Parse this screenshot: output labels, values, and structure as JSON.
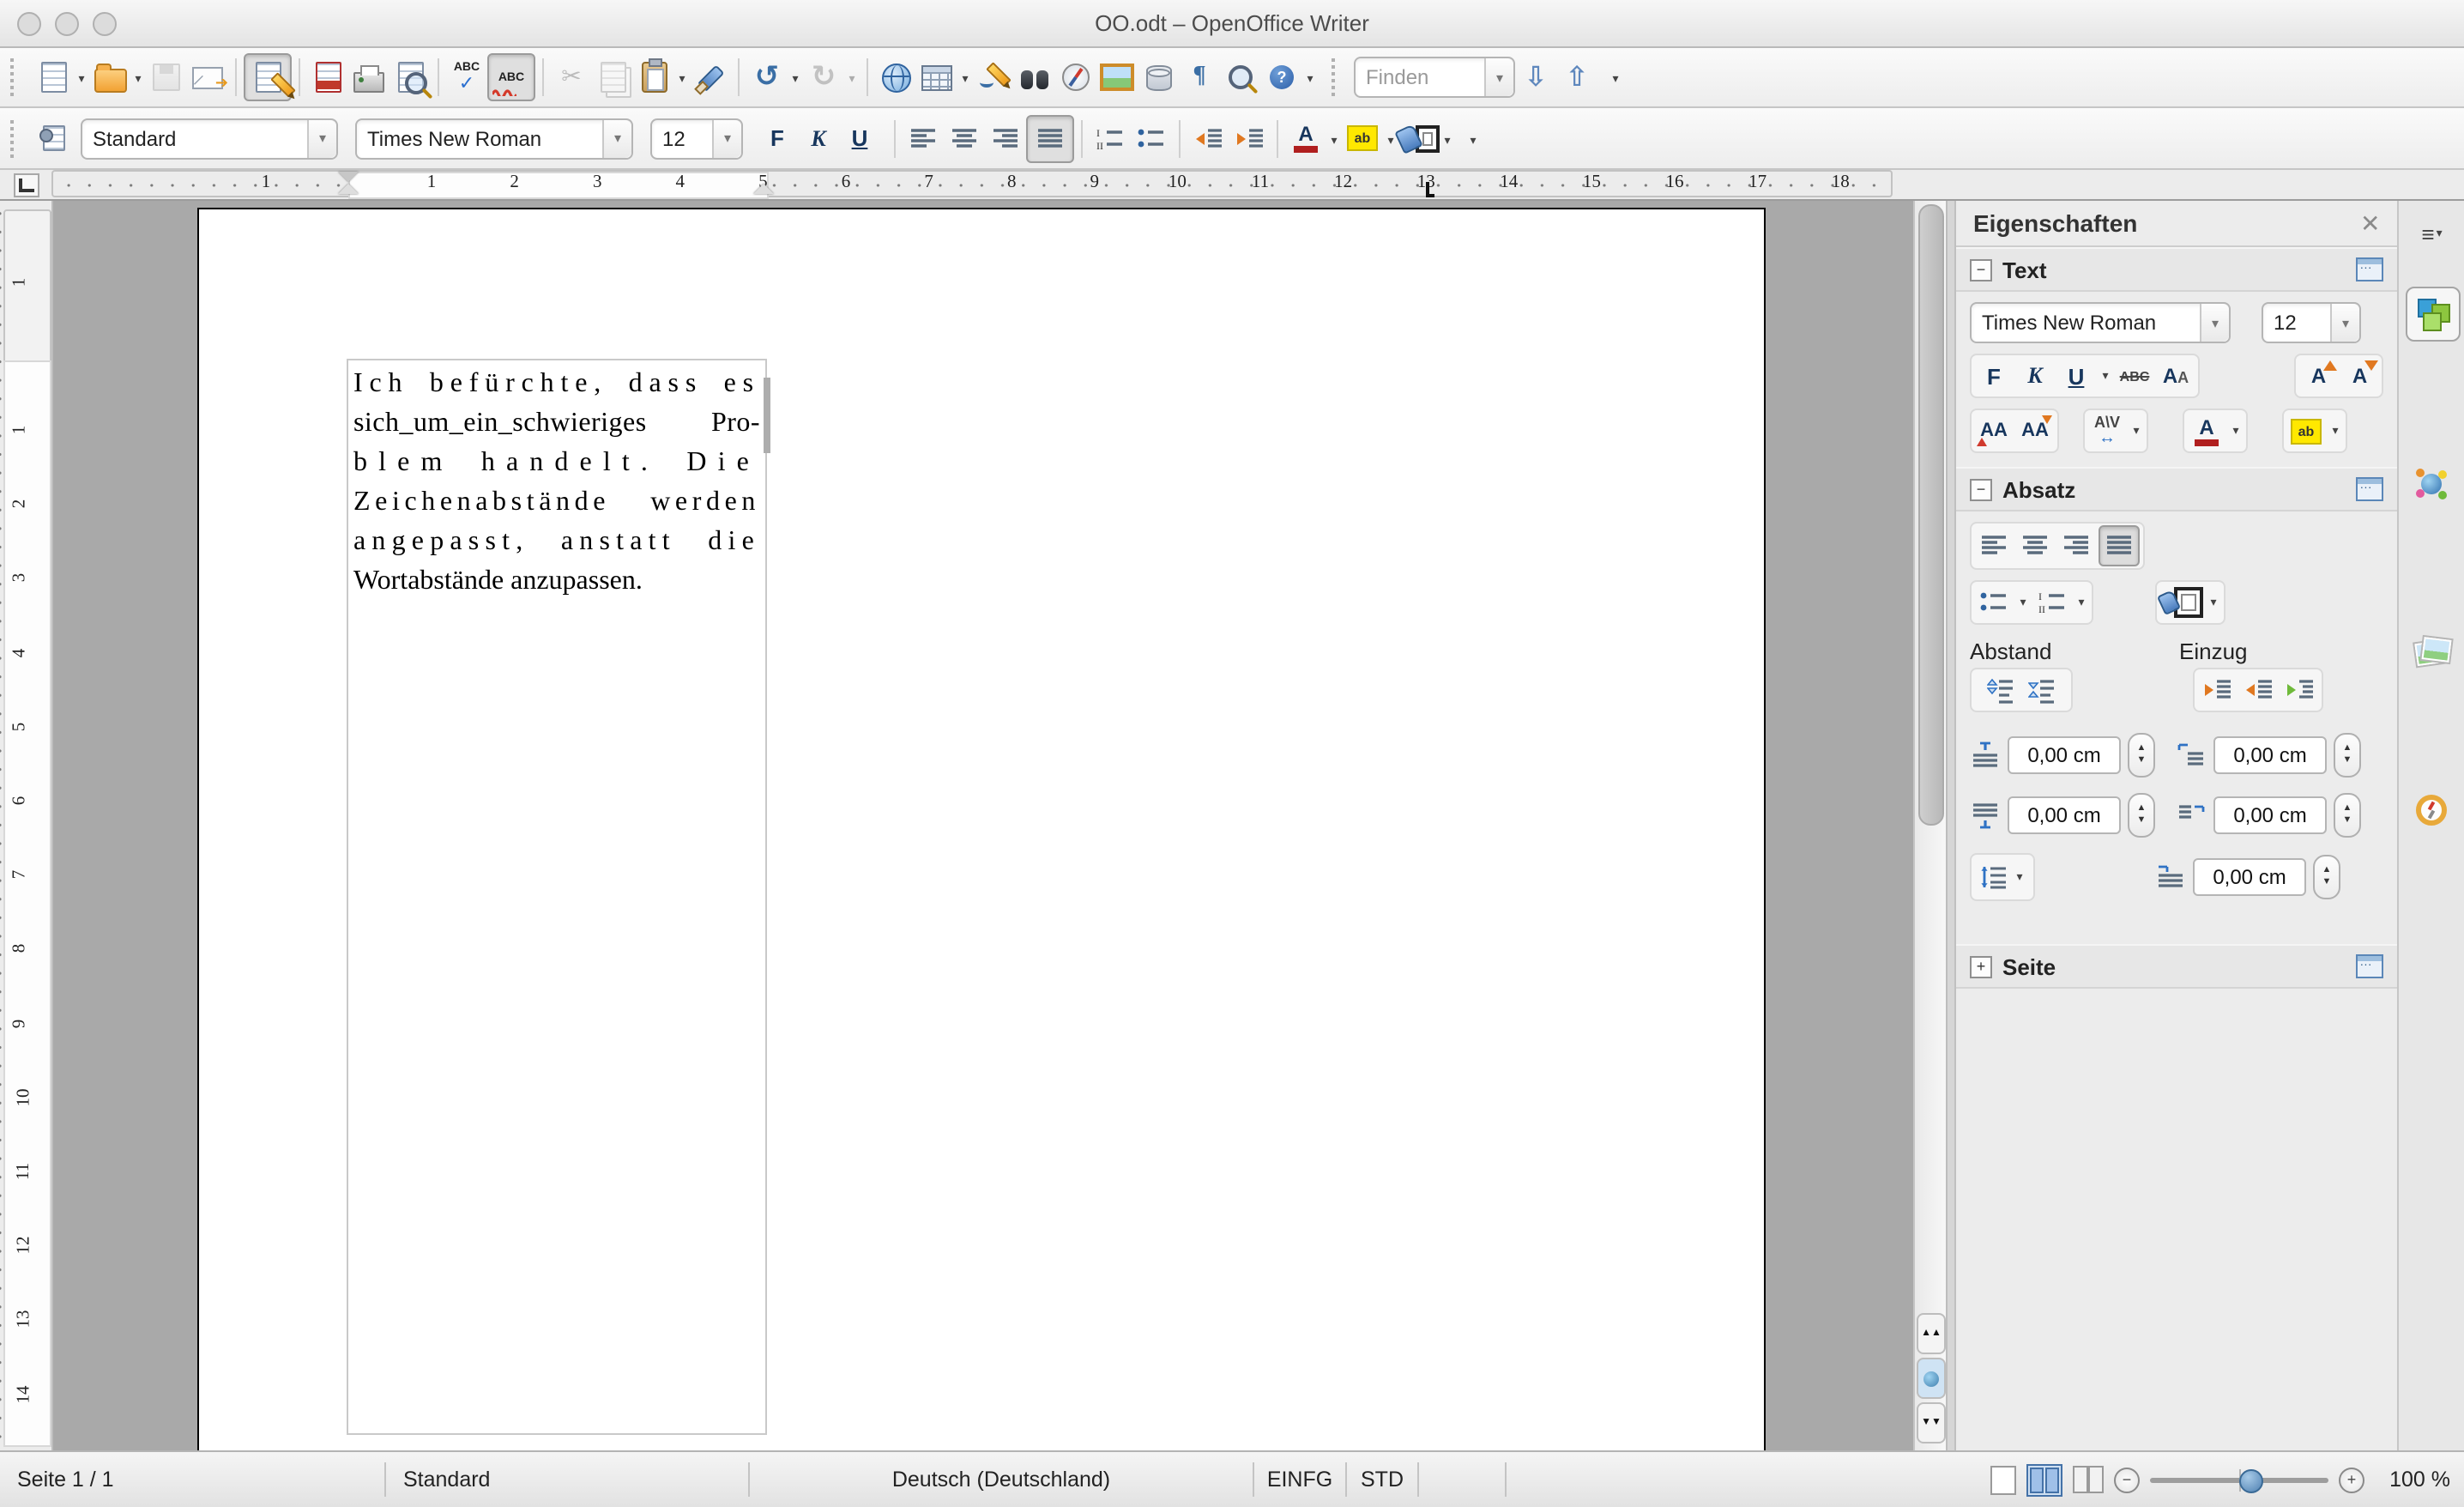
{
  "window": {
    "title": "OO.odt – OpenOffice Writer"
  },
  "icons": {
    "overflow": "▾",
    "scissors": "✂",
    "mail_arrow": "➔",
    "undo": "↺",
    "redo": "↻",
    "pilcrow": "¶",
    "check": "✓",
    "find_down": "⇩",
    "find_up": "⇧",
    "menu": "≡",
    "close": "✕",
    "minus": "−",
    "plus": "+",
    "spin_up": "▲",
    "spin_down": "▼",
    "nav_up": "▲▲",
    "nav_down": "▼▼",
    "abc": "ABC",
    "help": "?"
  },
  "toolbar_standard": {
    "find_placeholder": "Finden"
  },
  "toolbar_format": {
    "paragraph_style": "Standard",
    "font_name": "Times New Roman",
    "font_size": "12",
    "bold": "F",
    "italic": "K",
    "underline": "U"
  },
  "ruler": {
    "h_margin": "1",
    "h_numbers": [
      "1",
      "2",
      "3",
      "4",
      "5",
      "6",
      "7",
      "8",
      "9",
      "10",
      "11",
      "12",
      "13",
      "14",
      "15",
      "16",
      "17",
      "18"
    ],
    "v_margin": "1",
    "v_numbers": [
      "1",
      "2",
      "3",
      "4",
      "5",
      "6",
      "7",
      "8",
      "9",
      "10",
      "11",
      "12",
      "13",
      "14"
    ]
  },
  "document": {
    "lines": [
      "Ich befürchte, dass es",
      "sich_um_ein_schwieriges Pro-",
      "blem handelt. Die",
      "Zeichenabstände werden",
      "angepasst, anstatt die",
      "Wortabstände anzupassen."
    ]
  },
  "sidebar": {
    "title": "Eigenschaften",
    "text_section": {
      "label": "Text",
      "font_name": "Times New Roman",
      "font_size": "12",
      "bold": "F",
      "italic": "K",
      "underline": "U",
      "strikethrough": "ABC"
    },
    "absatz_section": {
      "label": "Absatz",
      "abstand_label": "Abstand",
      "einzug_label": "Einzug",
      "spacing_above": "0,00 cm",
      "spacing_below": "0,00 cm",
      "indent_before": "0,00 cm",
      "indent_after": "0,00 cm",
      "indent_firstline": "0,00 cm"
    },
    "seite_section": {
      "label": "Seite"
    }
  },
  "statusbar": {
    "page": "Seite 1 / 1",
    "style": "Standard",
    "language": "Deutsch (Deutschland)",
    "insert_mode": "EINFG",
    "selection_mode": "STD",
    "zoom": "100 %"
  }
}
